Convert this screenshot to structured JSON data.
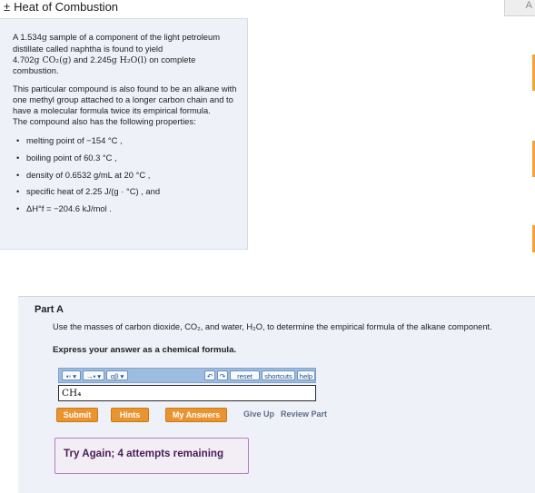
{
  "header": {
    "expand_symbol": "±",
    "title": "Heat of Combustion"
  },
  "intro": {
    "p1_a": "A 1.534",
    "p1_unit_g1": "g",
    "p1_b": " sample of a component of the light petroleum distillate called naphtha is found to yield",
    "p1_c": "4.702",
    "p1_co2": "g CO₂(g)",
    "p1_and": " and 2.245",
    "p1_h2o": "g H₂O(l)",
    "p1_d": " on complete combustion.",
    "p2": "This particular compound is also found to be an alkane with one methyl group attached to a longer carbon chain and to have a molecular formula twice its empirical formula.",
    "p3": "The compound also has the following properties:",
    "properties": [
      "melting point of −154 °C ,",
      "boiling point of 60.3 °C ,",
      "density of 0.6532 g/mL at 20 °C ,",
      "specific heat of 2.25 J/(g · °C) , and",
      "ΔH°f = −204.6 kJ/mol ."
    ]
  },
  "part": {
    "label": "Part A",
    "question": "Use the masses of carbon dioxide, CO₂, and water, H₂O, to determine the empirical formula of the alkane component.",
    "instruction": "Express your answer as a chemical formula.",
    "toolbar": {
      "templates_label": "▪▫ ▾",
      "arrows_label": "→▪ ▾",
      "greek_label": "αβ ▾",
      "undo_label": "↶",
      "redo_label": "↷",
      "reset_label": "reset",
      "shortcuts_label": "shortcuts",
      "help_label": "help"
    },
    "answer_value": "CH₄",
    "buttons": {
      "submit": "Submit",
      "hints": "Hints",
      "my_answers": "My Answers",
      "give_up": "Give Up",
      "review_part": "Review Part"
    },
    "feedback": "Try Again; 4 attempts remaining"
  },
  "colors": {
    "panel_bg": "#eef1f8",
    "button_orange": "#e9942f",
    "toolbar_blue": "#9dbde0",
    "feedback_border": "#b57fbf",
    "feedback_text": "#4a1d57"
  }
}
